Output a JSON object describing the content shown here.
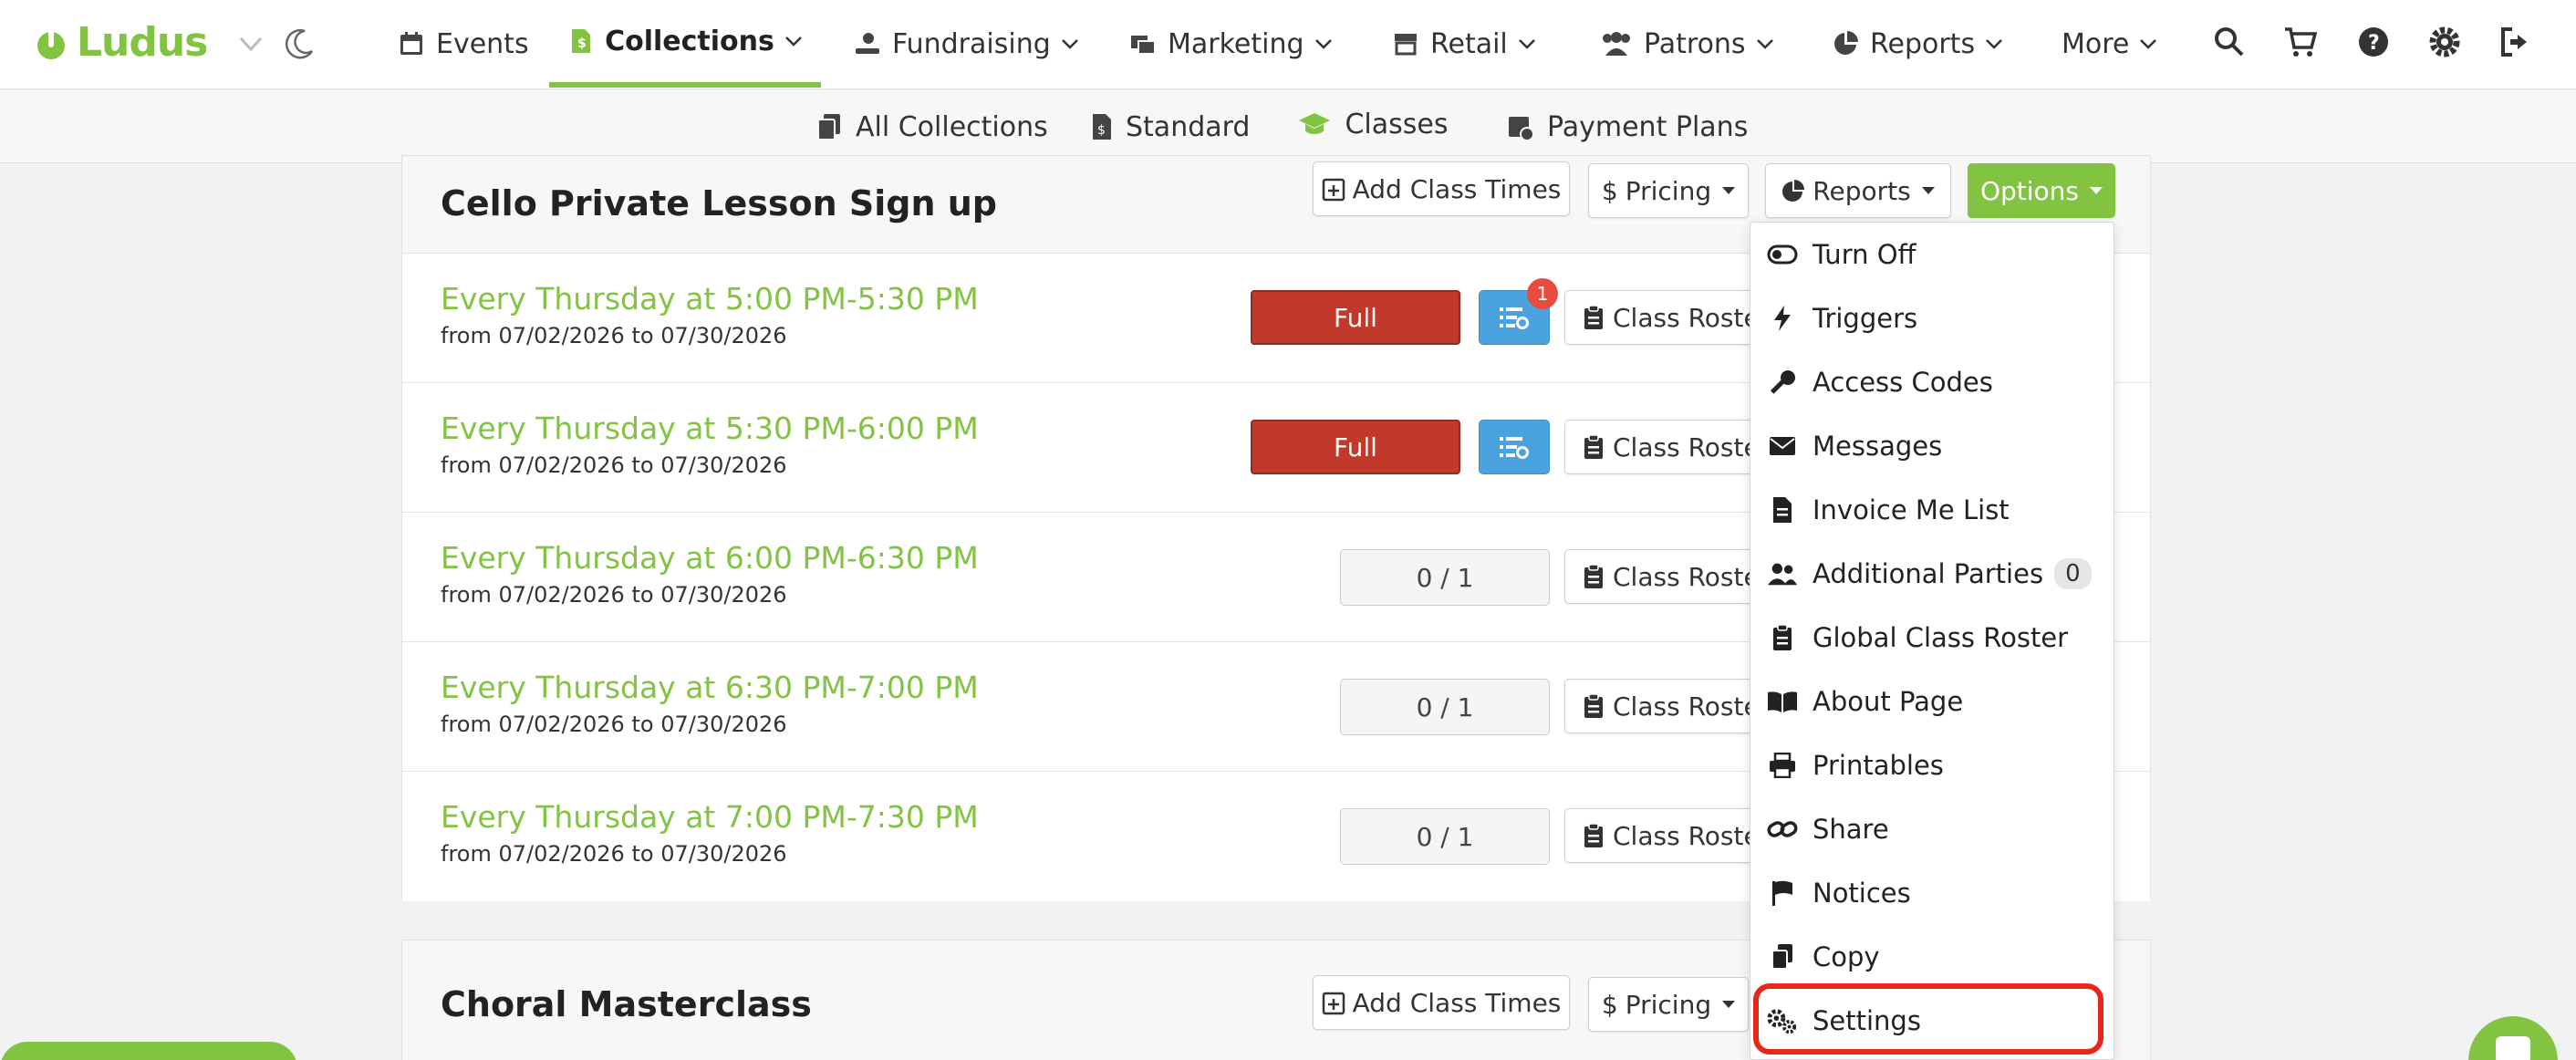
{
  "brand": {
    "name": "Ludus",
    "accent": "#82c341"
  },
  "topnav": {
    "items": [
      {
        "label": "Events",
        "icon": "calendar-icon"
      },
      {
        "label": "Collections",
        "icon": "collections-icon",
        "active": true
      },
      {
        "label": "Fundraising",
        "icon": "hand-donate-icon"
      },
      {
        "label": "Marketing",
        "icon": "mail-bulk-icon"
      },
      {
        "label": "Retail",
        "icon": "store-icon"
      },
      {
        "label": "Patrons",
        "icon": "users-icon"
      },
      {
        "label": "Reports",
        "icon": "pie-chart-icon"
      },
      {
        "label": "More",
        "icon": ""
      }
    ],
    "right_icons": [
      "search-icon",
      "cart-icon",
      "help-icon",
      "gear-icon",
      "sign-out-icon"
    ]
  },
  "subnav": {
    "items": [
      {
        "label": "All Collections",
        "icon": "copy-icon"
      },
      {
        "label": "Standard",
        "icon": "file-dollar-icon"
      },
      {
        "label": "Classes",
        "icon": "graduation-cap-icon",
        "active": true
      },
      {
        "label": "Payment Plans",
        "icon": "calendar-dollar-icon"
      }
    ]
  },
  "card1": {
    "title": "Cello Private Lesson Sign up",
    "buttons": {
      "add_times": "Add Class Times",
      "pricing": "Pricing",
      "reports": "Reports",
      "options": "Options"
    },
    "rows": [
      {
        "title": "Every Thursday at 5:00 PM-5:30 PM",
        "from": "07/02/2026",
        "to": "07/30/2026",
        "status": "Full",
        "waitlist_count": "1",
        "roster": "Class Roster"
      },
      {
        "title": "Every Thursday at 5:30 PM-6:00 PM",
        "from": "07/02/2026",
        "to": "07/30/2026",
        "status": "Full",
        "roster": "Class Roster"
      },
      {
        "title": "Every Thursday at 6:00 PM-6:30 PM",
        "from": "07/02/2026",
        "to": "07/30/2026",
        "count": "0 / 1",
        "roster": "Class Roster"
      },
      {
        "title": "Every Thursday at 6:30 PM-7:00 PM",
        "from": "07/02/2026",
        "to": "07/30/2026",
        "count": "0 / 1",
        "roster": "Class Roster"
      },
      {
        "title": "Every Thursday at 7:00 PM-7:30 PM",
        "from": "07/02/2026",
        "to": "07/30/2026",
        "count": "0 / 1",
        "roster": "Class Roster"
      }
    ],
    "from_word": "from",
    "to_word": "to"
  },
  "card2": {
    "title": "Choral Masterclass",
    "buttons": {
      "add_times": "Add Class Times",
      "pricing": "Pricing"
    }
  },
  "options_menu": {
    "items": [
      {
        "label": "Turn Off",
        "icon": "toggle-off-icon"
      },
      {
        "label": "Triggers",
        "icon": "bolt-icon"
      },
      {
        "label": "Access Codes",
        "icon": "key-icon"
      },
      {
        "label": "Messages",
        "icon": "envelope-icon"
      },
      {
        "label": "Invoice Me List",
        "icon": "file-invoice-icon"
      },
      {
        "label": "Additional Parties",
        "icon": "user-friends-icon",
        "badge": "0"
      },
      {
        "label": "Global Class Roster",
        "icon": "clipboard-list-icon"
      },
      {
        "label": "About Page",
        "icon": "book-open-icon"
      },
      {
        "label": "Printables",
        "icon": "print-icon"
      },
      {
        "label": "Share",
        "icon": "link-icon"
      },
      {
        "label": "Notices",
        "icon": "flag-icon"
      },
      {
        "label": "Copy",
        "icon": "copy-icon"
      },
      {
        "label": "Settings",
        "icon": "cogs-icon",
        "highlighted": true
      }
    ]
  },
  "colors": {
    "full": "#c0392b",
    "waitlist": "#4aa3df",
    "badge": "#e74c3c",
    "highlight": "#e8261a"
  }
}
